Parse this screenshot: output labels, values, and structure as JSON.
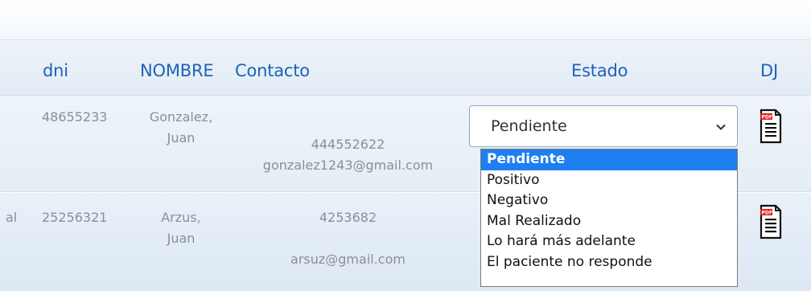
{
  "table": {
    "headers": {
      "dni": "dni",
      "nombre": "NOMBRE",
      "contacto": "Contacto",
      "estado": "Estado",
      "dj": "DJ"
    },
    "rows": [
      {
        "dni": "48655233",
        "nombre_line1": "Gonzalez,",
        "nombre_line2": "Juan",
        "phone": "444552622",
        "email": "gonzalez1243@gmail.com",
        "estado": "Pendiente"
      },
      {
        "prefix_fragment": "al",
        "dni": "25256321",
        "nombre_line1": "Arzus,",
        "nombre_line2": "Juan",
        "phone": "4253682",
        "email": "arsuz@gmail.com"
      }
    ]
  },
  "estado_dropdown": {
    "options": [
      "Pendiente",
      "Positivo",
      "Negativo",
      "Mal Realizado",
      "Lo hará más adelante",
      "El paciente no responde"
    ],
    "selected_index": 0
  },
  "colors": {
    "header_text": "#1c63b8",
    "selected_option_bg": "#1f7ff2",
    "cell_text": "#8a8f96",
    "pdf_red": "#e02020"
  },
  "icons": {
    "dj_icon": "pdf-icon",
    "select_arrow": "chevron-down-icon"
  }
}
